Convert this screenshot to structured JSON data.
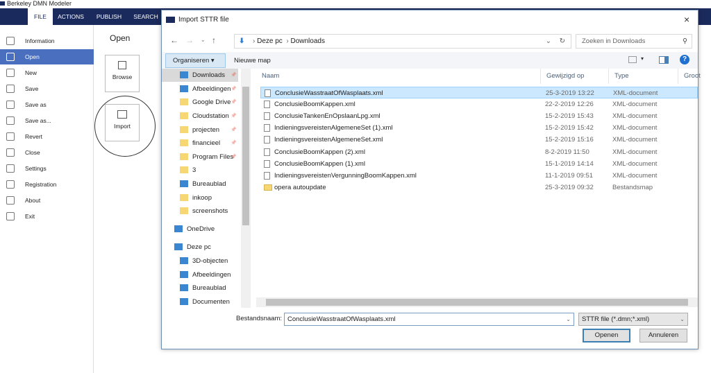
{
  "app": {
    "title": "Berkeley DMN Modeler",
    "tabs": [
      "FILE",
      "ACTIONS",
      "PUBLISH",
      "SEARCH"
    ],
    "active_tab": "FILE",
    "accent": "#1b2a5c",
    "highlight": "#4a6fbf"
  },
  "sidebar": {
    "items": [
      {
        "label": "Information",
        "icon": "info-icon"
      },
      {
        "label": "Open",
        "icon": "open-folder-icon",
        "selected": true
      },
      {
        "label": "New",
        "icon": "new-icon"
      },
      {
        "label": "Save",
        "icon": "save-icon"
      },
      {
        "label": "Save as",
        "icon": "save-as-icon"
      },
      {
        "label": "Save as...",
        "icon": "save-as-icon"
      },
      {
        "label": "Revert",
        "icon": "revert-icon"
      },
      {
        "label": "Close",
        "icon": "close-icon"
      },
      {
        "label": "Settings",
        "icon": "gear-icon"
      },
      {
        "label": "Registration",
        "icon": "registration-icon"
      },
      {
        "label": "About",
        "icon": "info-icon"
      },
      {
        "label": "Exit",
        "icon": "exit-icon"
      }
    ]
  },
  "open_panel": {
    "title": "Open",
    "browse": "Browse",
    "import": "Import"
  },
  "dialog": {
    "title": "Import STTR file",
    "close": "×",
    "breadcrumb": [
      "Deze pc",
      "Downloads"
    ],
    "search_placeholder": "Zoeken in Downloads",
    "organize": "Organiseren ▾",
    "new_folder": "Nieuwe map",
    "nav": [
      {
        "label": "Downloads",
        "pinned": true,
        "selected": true
      },
      {
        "label": "Afbeeldingen",
        "pinned": true
      },
      {
        "label": "Google Drive",
        "pinned": true
      },
      {
        "label": "Cloudstation",
        "pinned": true
      },
      {
        "label": "projecten",
        "pinned": true
      },
      {
        "label": "financieel",
        "pinned": true
      },
      {
        "label": "Program Files",
        "pinned": true
      },
      {
        "label": "3"
      },
      {
        "label": "Bureaublad"
      },
      {
        "label": "inkoop"
      },
      {
        "label": "screenshots"
      },
      {
        "label": "OneDrive",
        "drive": true
      },
      {
        "label": "Deze pc",
        "drive": true
      },
      {
        "label": "3D-objecten"
      },
      {
        "label": "Afbeeldingen"
      },
      {
        "label": "Bureaublad"
      },
      {
        "label": "Documenten"
      }
    ],
    "columns": [
      "Naam",
      "Gewijzigd op",
      "Type",
      "Groot"
    ],
    "files": [
      {
        "name": "ConclusieWasstraatOfWasplaats.xml",
        "date": "25-3-2019 13:22",
        "type": "XML-document",
        "selected": true
      },
      {
        "name": "ConclusieBoomKappen.xml",
        "date": "22-2-2019 12:26",
        "type": "XML-document"
      },
      {
        "name": "ConclusieTankenEnOpslaanLpg.xml",
        "date": "15-2-2019 15:43",
        "type": "XML-document"
      },
      {
        "name": "IndieningsvereistenAlgemeneSet (1).xml",
        "date": "15-2-2019 15:42",
        "type": "XML-document"
      },
      {
        "name": "IndieningsvereistenAlgemeneSet.xml",
        "date": "15-2-2019 15:16",
        "type": "XML-document"
      },
      {
        "name": "ConclusieBoomKappen (2).xml",
        "date": "8-2-2019 11:50",
        "type": "XML-document"
      },
      {
        "name": "ConclusieBoomKappen (1).xml",
        "date": "15-1-2019 14:14",
        "type": "XML-document"
      },
      {
        "name": "IndieningsvereistenVergunningBoomKappen.xml",
        "date": "11-1-2019 09:51",
        "type": "XML-document"
      },
      {
        "name": "opera autoupdate",
        "date": "25-3-2019 09:32",
        "type": "Bestandsmap",
        "folder": true
      }
    ],
    "filename_label": "Bestandsnaam:",
    "filename_value": "ConclusieWasstraatOfWasplaats.xml",
    "filetype": "STTR file (*.dmn;*.xml)",
    "open_button": "Openen",
    "cancel_button": "Annuleren"
  }
}
